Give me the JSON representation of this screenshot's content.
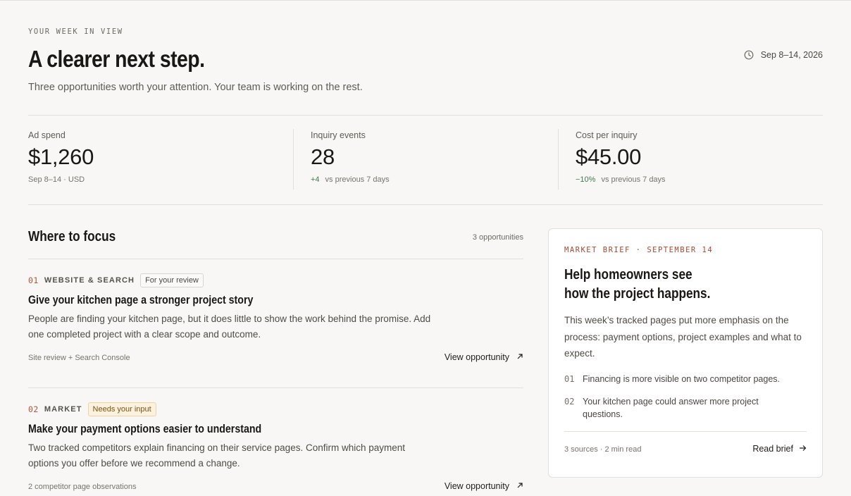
{
  "header": {
    "eyebrow": "YOUR WEEK IN VIEW",
    "title": "A clearer next step.",
    "subtitle": "Three opportunities worth your attention. Your team is working on the rest.",
    "date_range": "Sep 8–14, 2026",
    "date_icon": "clock-icon"
  },
  "stats": [
    {
      "label": "Ad spend",
      "value": "$1,260",
      "meta": "Sep 8–14 · USD"
    },
    {
      "label": "Inquiry events",
      "value": "28",
      "delta": "+4",
      "meta": "vs previous 7 days"
    },
    {
      "label": "Cost per inquiry",
      "value": "$45.00",
      "delta": "−10%",
      "meta": "vs previous 7 days"
    }
  ],
  "focus": {
    "title": "Where to focus",
    "count": "3 opportunities",
    "items": [
      {
        "num": "01",
        "category": "WEBSITE & SEARCH",
        "badge": "For your review",
        "title": "Give your kitchen page a stronger project story",
        "body": "People are finding your kitchen page, but it does little to show the work behind the promise. Add one completed project with a clear scope and outcome.",
        "source": "Site review + Search Console",
        "link": "View opportunity"
      },
      {
        "num": "02",
        "category": "MARKET",
        "badge": "Needs your input",
        "title": "Make your payment options easier to understand",
        "body": "Two tracked competitors explain financing on their service pages. Confirm which payment options you offer before we recommend a change.",
        "source": "2 competitor page observations",
        "link": "View opportunity"
      }
    ]
  },
  "brief": {
    "eyebrow": "MARKET BRIEF · SEPTEMBER 14",
    "title_line1": "Help homeowners see",
    "title_line2": "how the project happens.",
    "body": "This week’s tracked pages put more emphasis on the process: payment options, project examples and what to expect.",
    "points": [
      {
        "num": "01",
        "text": "Financing is more visible on two competitor pages."
      },
      {
        "num": "02",
        "text": "Your kitchen page could answer more project questions."
      }
    ],
    "meta": "3 sources · 2 min read",
    "link": "Read brief"
  },
  "colors": {
    "background": "#f8f7f5",
    "accent": "#a54a32",
    "positive": "#3f7a4f",
    "warn_badge": "#fbf1dc"
  }
}
